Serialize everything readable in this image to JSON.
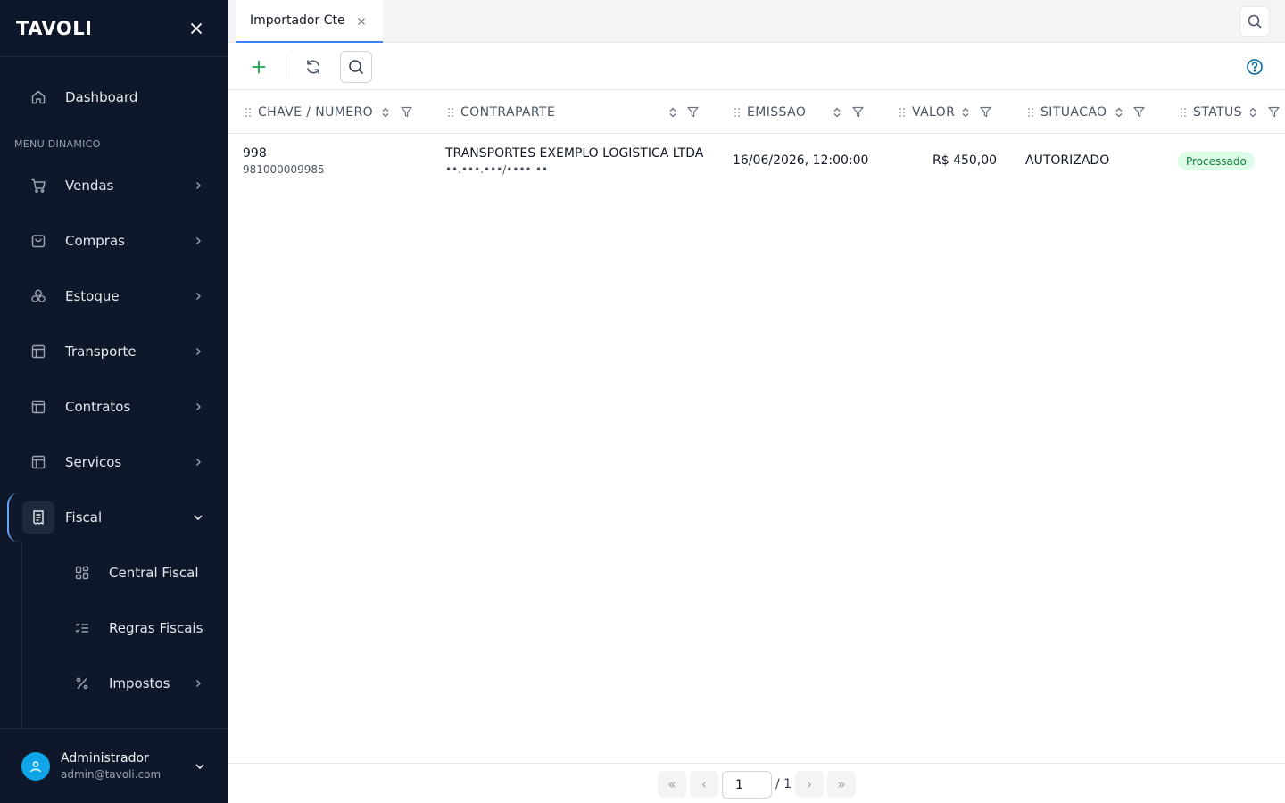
{
  "sidebar": {
    "logo": "TAVOLI",
    "section_title": "MENU DINAMICO",
    "items": [
      {
        "label": "Dashboard",
        "icon": "home-icon"
      },
      {
        "label": "Vendas",
        "icon": "cart-icon"
      },
      {
        "label": "Compras",
        "icon": "bag-icon"
      },
      {
        "label": "Estoque",
        "icon": "boxes-icon"
      },
      {
        "label": "Transporte",
        "icon": "layout-icon"
      },
      {
        "label": "Contratos",
        "icon": "layout-icon"
      },
      {
        "label": "Servicos",
        "icon": "layout-icon"
      },
      {
        "label": "Fiscal",
        "icon": "receipt-icon",
        "active": true
      }
    ],
    "sub_items": [
      {
        "label": "Central Fiscal",
        "icon": "grid-icon"
      },
      {
        "label": "Regras Fiscais",
        "icon": "checklist-icon"
      },
      {
        "label": "Impostos",
        "icon": "percent-icon"
      }
    ],
    "user": {
      "name": "Administrador",
      "email": "admin@tavoli.com"
    }
  },
  "tabs": [
    {
      "label": "Importador Cte"
    }
  ],
  "table": {
    "columns": [
      "CHAVE / NUMERO",
      "CONTRAPARTE",
      "EMISSAO",
      "VALOR",
      "SITUACAO",
      "STATUS"
    ],
    "rows": [
      {
        "numero": "998",
        "chave": "981000009985",
        "contraparte": "TRANSPORTES EXEMPLO LOGISTICA LTDA",
        "documento": "••.•••.•••/••••-••",
        "emissao": "16/06/2026, 12:00:00",
        "valor": "R$ 450,00",
        "situacao": "AUTORIZADO",
        "status": "Processado"
      }
    ]
  },
  "pagination": {
    "current": "1",
    "total": "/ 1",
    "first": "«",
    "prev": "‹",
    "next": "›",
    "last": "»"
  },
  "colors": {
    "sidebar_bg": "#0f172a",
    "accent": "#3b82f6",
    "success_bg": "#dcfce7",
    "success_text": "#15803d",
    "add_green": "#16a34a",
    "help_blue": "#0369a1"
  }
}
